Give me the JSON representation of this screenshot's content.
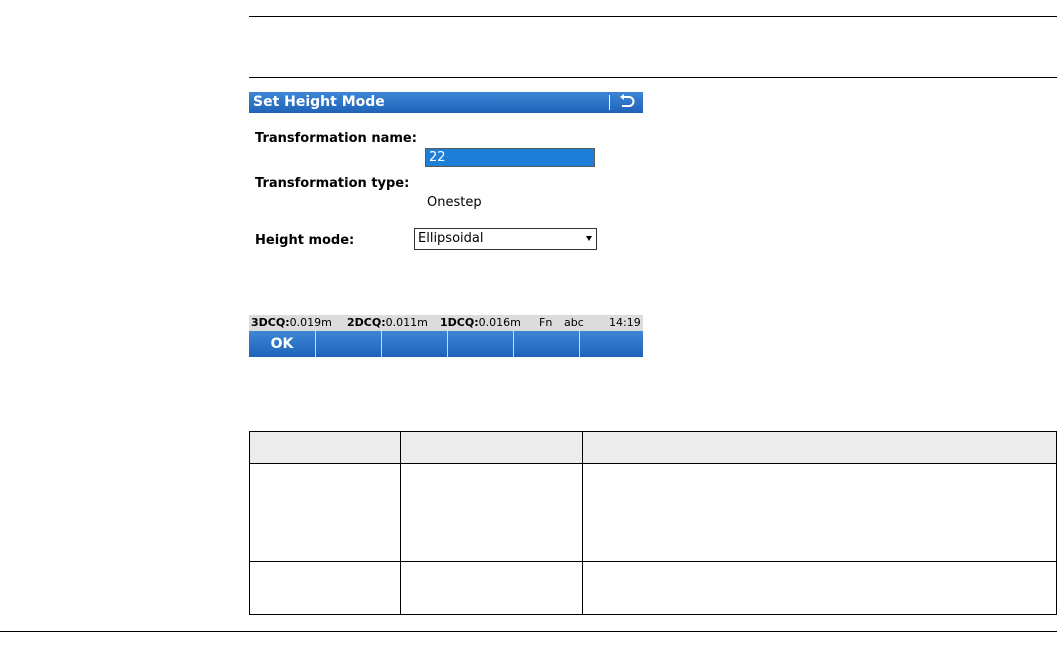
{
  "screen": {
    "title": "Set Height Mode",
    "fields": {
      "transformation_name_label": "Transformation name:",
      "transformation_name_value": "22",
      "transformation_type_label": "Transformation type:",
      "transformation_type_value": "Onestep",
      "height_mode_label": "Height mode:",
      "height_mode_value": "Ellipsoidal"
    },
    "status": {
      "q3d_label": "3DCQ:",
      "q3d_value": "0.019m",
      "q2d_label": "2DCQ:",
      "q2d_value": "0.011m",
      "q1d_label": "1DCQ:",
      "q1d_value": "0.016m",
      "fn": "Fn",
      "input_mode": "abc",
      "time": "14:19"
    },
    "softkeys": [
      "OK",
      "",
      "",
      "",
      "",
      ""
    ]
  },
  "colors": {
    "titlebar": "#1f63b8",
    "selection": "#1e7fd8",
    "statusbar": "#dcdcdc"
  },
  "icons": {
    "back": "back-arrow-icon",
    "dropdown": "dropdown-arrow-icon"
  }
}
